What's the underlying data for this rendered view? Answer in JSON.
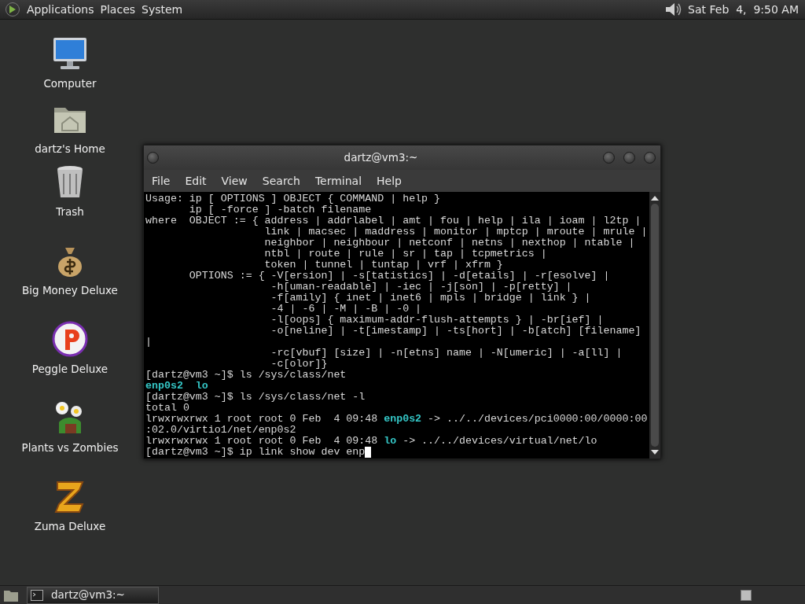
{
  "top_panel": {
    "menus": [
      "Applications",
      "Places",
      "System"
    ],
    "clock": "Sat Feb  4,  9:50 AM"
  },
  "desktop_icons": [
    {
      "label": "Computer",
      "kind": "computer"
    },
    {
      "label": "dartz's Home",
      "kind": "home"
    },
    {
      "label": "Trash",
      "kind": "trash"
    },
    {
      "label": "Big Money Deluxe",
      "kind": "money"
    },
    {
      "label": "Peggle Deluxe",
      "kind": "peggle"
    },
    {
      "label": "Plants vs Zombies",
      "kind": "plants"
    },
    {
      "label": "Zuma Deluxe",
      "kind": "zuma"
    }
  ],
  "terminal": {
    "title": "dartz@vm3:~",
    "menu": [
      "File",
      "Edit",
      "View",
      "Search",
      "Terminal",
      "Help"
    ],
    "cursor": true,
    "lines": [
      [
        {
          "kind": "plain",
          "text": "Usage: ip [ OPTIONS ] OBJECT { COMMAND | help }"
        }
      ],
      [
        {
          "kind": "plain",
          "text": "       ip [ -force ] -batch filename"
        }
      ],
      [
        {
          "kind": "plain",
          "text": "where  OBJECT := { address | addrlabel | amt | fou | help | ila | ioam | l2tp |"
        }
      ],
      [
        {
          "kind": "plain",
          "text": "                   link | macsec | maddress | monitor | mptcp | mroute | mrule |"
        }
      ],
      [
        {
          "kind": "plain",
          "text": "                   neighbor | neighbour | netconf | netns | nexthop | ntable |"
        }
      ],
      [
        {
          "kind": "plain",
          "text": "                   ntbl | route | rule | sr | tap | tcpmetrics |"
        }
      ],
      [
        {
          "kind": "plain",
          "text": "                   token | tunnel | tuntap | vrf | xfrm }"
        }
      ],
      [
        {
          "kind": "plain",
          "text": "       OPTIONS := { -V[ersion] | -s[tatistics] | -d[etails] | -r[esolve] |"
        }
      ],
      [
        {
          "kind": "plain",
          "text": "                    -h[uman-readable] | -iec | -j[son] | -p[retty] |"
        }
      ],
      [
        {
          "kind": "plain",
          "text": "                    -f[amily] { inet | inet6 | mpls | bridge | link } |"
        }
      ],
      [
        {
          "kind": "plain",
          "text": "                    -4 | -6 | -M | -B | -0 |"
        }
      ],
      [
        {
          "kind": "plain",
          "text": "                    -l[oops] { maximum-addr-flush-attempts } | -br[ief] |"
        }
      ],
      [
        {
          "kind": "plain",
          "text": "                    -o[neline] | -t[imestamp] | -ts[hort] | -b[atch] [filename]"
        }
      ],
      [
        {
          "kind": "plain",
          "text": "|"
        }
      ],
      [
        {
          "kind": "plain",
          "text": "                    -rc[vbuf] [size] | -n[etns] name | -N[umeric] | -a[ll] |"
        }
      ],
      [
        {
          "kind": "plain",
          "text": "                    -c[olor]}"
        }
      ],
      [
        {
          "kind": "plain",
          "text": "[dartz@vm3 ~]$ ls /sys/class/net"
        }
      ],
      [
        {
          "kind": "dir",
          "text": "enp0s2  "
        },
        {
          "kind": "dir",
          "text": "lo"
        }
      ],
      [
        {
          "kind": "plain",
          "text": "[dartz@vm3 ~]$ ls /sys/class/net -l"
        }
      ],
      [
        {
          "kind": "plain",
          "text": "total 0"
        }
      ],
      [
        {
          "kind": "plain",
          "text": "lrwxrwxrwx 1 root root 0 Feb  4 09:48 "
        },
        {
          "kind": "dir",
          "text": "enp0s2"
        },
        {
          "kind": "plain",
          "text": " -> ../../devices/pci0000:00/0000:00"
        }
      ],
      [
        {
          "kind": "plain",
          "text": ":02.0/virtio1/net/enp0s2"
        }
      ],
      [
        {
          "kind": "plain",
          "text": "lrwxrwxrwx 1 root root 0 Feb  4 09:48 "
        },
        {
          "kind": "dir",
          "text": "lo"
        },
        {
          "kind": "plain",
          "text": " -> ../../devices/virtual/net/lo"
        }
      ],
      [
        {
          "kind": "plain",
          "text": "[dartz@vm3 ~]$ ip link show dev enp"
        }
      ]
    ]
  },
  "taskbar": {
    "tasks": [
      {
        "label": "dartz@vm3:~",
        "selected": true
      }
    ]
  }
}
